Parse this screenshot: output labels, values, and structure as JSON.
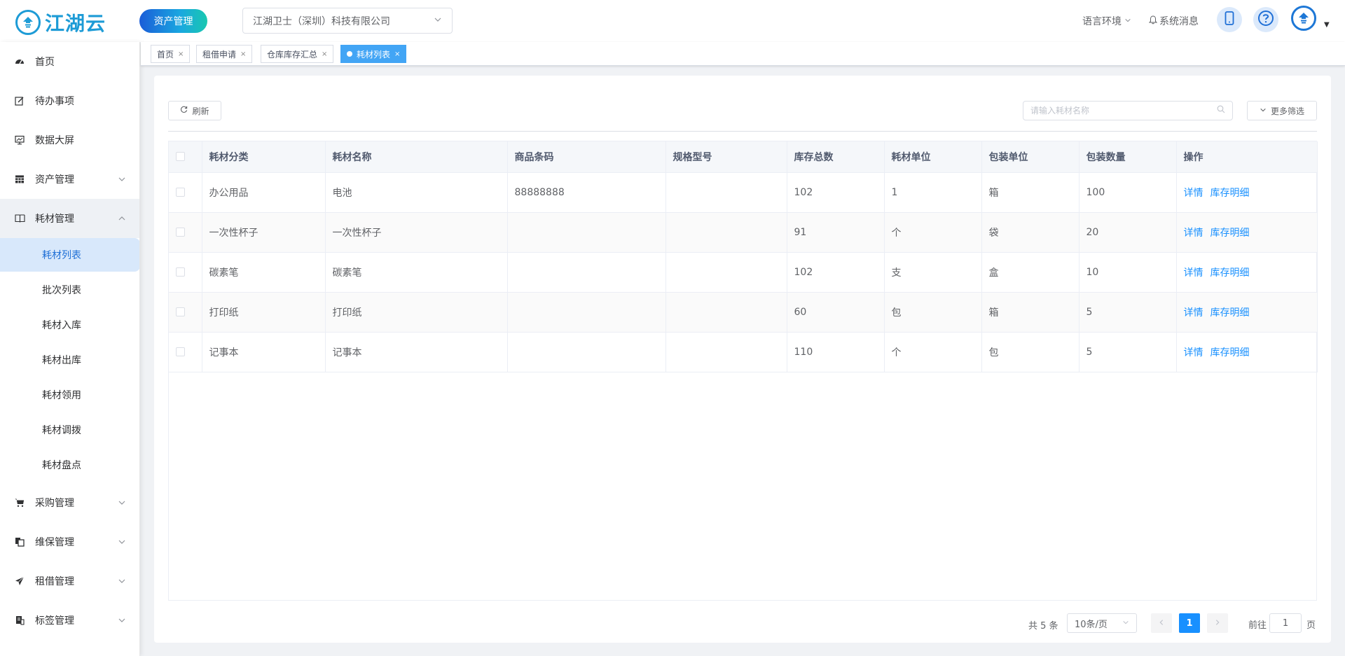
{
  "header": {
    "logo_text": "江湖云",
    "module_label": "资产管理",
    "company": "江湖卫士（深圳）科技有限公司",
    "lang_label": "语言环境",
    "msg_label": "系统消息"
  },
  "sidebar": {
    "items": [
      {
        "label": "首页",
        "icon": "dashboard-icon"
      },
      {
        "label": "待办事项",
        "icon": "edit-icon"
      },
      {
        "label": "数据大屏",
        "icon": "monitor-icon"
      },
      {
        "label": "资产管理",
        "icon": "table-icon"
      },
      {
        "label": "耗材管理",
        "icon": "book-icon"
      },
      {
        "label": "采购管理",
        "icon": "cart-icon"
      },
      {
        "label": "维保管理",
        "icon": "copy-icon"
      },
      {
        "label": "租借管理",
        "icon": "send-icon"
      },
      {
        "label": "标签管理",
        "icon": "printer-icon"
      }
    ],
    "sub_items": [
      "耗材列表",
      "批次列表",
      "耗材入库",
      "耗材出库",
      "耗材领用",
      "耗材调拨",
      "耗材盘点"
    ]
  },
  "tags": [
    "首页",
    "租借申请",
    "仓库库存汇总",
    "耗材列表"
  ],
  "toolbar": {
    "refresh_label": "刷新",
    "search_placeholder": "请输入耗材名称",
    "more_filter_label": "更多筛选"
  },
  "table": {
    "columns": [
      "耗材分类",
      "耗材名称",
      "商品条码",
      "规格型号",
      "库存总数",
      "耗材单位",
      "包装单位",
      "包装数量",
      "操作"
    ],
    "rows": [
      [
        "办公用品",
        "电池",
        "88888888",
        "",
        "102",
        "1",
        "箱",
        "100"
      ],
      [
        "一次性杯子",
        "一次性杯子",
        "",
        "",
        "91",
        "个",
        "袋",
        "20"
      ],
      [
        "碳素笔",
        "碳素笔",
        "",
        "",
        "102",
        "支",
        "盒",
        "10"
      ],
      [
        "打印纸",
        "打印纸",
        "",
        "",
        "60",
        "包",
        "箱",
        "5"
      ],
      [
        "记事本",
        "记事本",
        "",
        "",
        "110",
        "个",
        "包",
        "5"
      ]
    ],
    "action_detail": "详情",
    "action_stock": "库存明细"
  },
  "pagination": {
    "total": "共 5 条",
    "page_size": "10条/页",
    "current_page": "1",
    "goto_label": "前往",
    "goto_value": "1",
    "goto_unit": "页"
  },
  "colors": {
    "brand": "#1d9bd6",
    "primary": "#1890ff",
    "active_tag": "#42a5f5"
  }
}
